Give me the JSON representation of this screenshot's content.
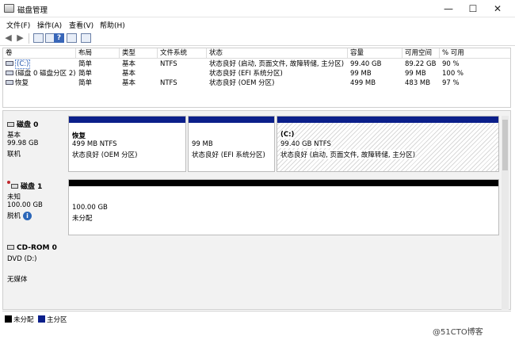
{
  "window": {
    "title": "磁盘管理",
    "minimize": "—",
    "maximize": "☐",
    "close": "✕"
  },
  "menu": [
    "文件(F)",
    "操作(A)",
    "查看(V)",
    "帮助(H)"
  ],
  "toolbar": {
    "help": "?"
  },
  "volume_table": {
    "headers": [
      "卷",
      "布局",
      "类型",
      "文件系统",
      "状态",
      "容量",
      "可用空间",
      "% 可用"
    ],
    "rows": [
      {
        "name": "(C:)",
        "layout": "简单",
        "type": "基本",
        "fs": "NTFS",
        "status": "状态良好 (启动, 页面文件, 故障转储, 主分区)",
        "capacity": "99.40 GB",
        "free": "89.22 GB",
        "pct": "90 %"
      },
      {
        "name": "(磁盘 0 磁盘分区 2)",
        "layout": "简单",
        "type": "基本",
        "fs": "",
        "status": "状态良好 (EFI 系统分区)",
        "capacity": "99 MB",
        "free": "99 MB",
        "pct": "100 %"
      },
      {
        "name": "恢复",
        "layout": "简单",
        "type": "基本",
        "fs": "NTFS",
        "status": "状态良好 (OEM 分区)",
        "capacity": "499 MB",
        "free": "483 MB",
        "pct": "97 %"
      }
    ]
  },
  "disks": [
    {
      "name": "磁盘 0",
      "kind": "基本",
      "size": "99.98 GB",
      "state": "联机",
      "partitions": [
        {
          "title": "恢复",
          "size_fs": "499 MB NTFS",
          "status": "状态良好 (OEM 分区)"
        },
        {
          "title": "",
          "size_fs": "99 MB",
          "status": "状态良好 (EFI 系统分区)"
        },
        {
          "title": "(C:)",
          "size_fs": "99.40 GB NTFS",
          "status": "状态良好 (启动, 页面文件, 故障转储, 主分区)"
        }
      ]
    },
    {
      "name": "磁盘 1",
      "kind": "未知",
      "size": "100.00 GB",
      "state": "脱机",
      "partitions": [
        {
          "size": "100.00 GB",
          "status": "未分配"
        }
      ]
    },
    {
      "name": "CD-ROM 0",
      "kind": "DVD (D:)",
      "state": "无媒体"
    }
  ],
  "legend": [
    {
      "label": "未分配",
      "color": "#000000"
    },
    {
      "label": "主分区",
      "color": "#0b1f8a"
    }
  ],
  "watermark": "@51CTO博客",
  "colors": {
    "primary_partition": "#0b1f8a",
    "unallocated": "#000000",
    "selection": "#3a6ec8"
  }
}
